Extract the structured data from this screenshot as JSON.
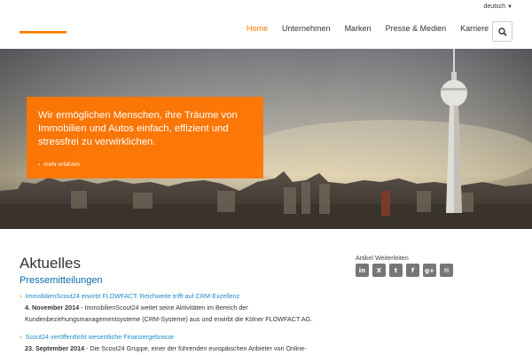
{
  "lang": {
    "label": "deutsch"
  },
  "nav": {
    "items": [
      {
        "label": "Home",
        "active": true
      },
      {
        "label": "Unternehmen"
      },
      {
        "label": "Marken"
      },
      {
        "label": "Presse & Medien"
      },
      {
        "label": "Karriere"
      }
    ]
  },
  "hero": {
    "text": "Wir ermöglichen Menschen, ihre Träume von Immobilien und Autos einfach, effizient und stressfrei zu verwirklichen.",
    "link": "mehr erfahren"
  },
  "content": {
    "heading": "Aktuelles",
    "subheading": "Pressemitteilungen",
    "news": [
      {
        "title": "ImmobilienScout24 erwirbt FLOWFACT: Reichweite trifft auf CRM-Exzellenz",
        "date": "4. November 2014",
        "text": " - ImmobilienScout24 weitet seine Aktivitäten im Bereich der",
        "text2": "Kundenbeziehungsmanagementsysteme (CRM-Systeme) aus und erwirbt die Kölner FLOWFACT AG."
      },
      {
        "title": "Scout24 veröffentlicht wesentliche Finanzergebnisse",
        "date": "23. September 2014",
        "text": " - Die Scout24 Gruppe, einer der führenden europäischen Anbieter von Online-"
      }
    ]
  },
  "share": {
    "label": "Artikel Weiterleiten",
    "icons": [
      "in",
      "X",
      "t",
      "f",
      "g+",
      "✉"
    ]
  },
  "colors": {
    "accent": "#ff7500",
    "link": "#1b8bc7"
  }
}
